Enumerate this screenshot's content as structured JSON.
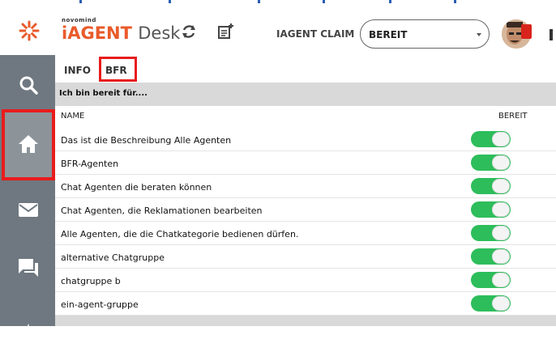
{
  "header": {
    "brand_small": "novomind",
    "brand_main": "iAGENT",
    "brand_desk": "Desk",
    "claim_label": "IAGENT CLAIM",
    "status_value": "BEREIT"
  },
  "tabs": [
    {
      "label": "INFO"
    },
    {
      "label": "BFR"
    }
  ],
  "section": {
    "title": "Ich bin bereit für....",
    "col_name": "NAME",
    "col_ready": "BEREIT"
  },
  "groups": [
    {
      "name": "Das ist die Beschreibung Alle Agenten",
      "ready": true
    },
    {
      "name": "BFR-Agenten",
      "ready": true
    },
    {
      "name": "Chat Agenten die beraten können",
      "ready": true
    },
    {
      "name": "Chat Agenten, die Reklamationen bearbeiten",
      "ready": true
    },
    {
      "name": "Alle Agenten, die die Chatkategorie bedienen dürfen.",
      "ready": true
    },
    {
      "name": "alternative Chatgruppe",
      "ready": true
    },
    {
      "name": "chatgruppe b",
      "ready": true
    },
    {
      "name": "ein-agent-gruppe",
      "ready": true
    }
  ],
  "colors": {
    "brand": "#e95a2b",
    "sidebar": "#6f7880",
    "toggle_on": "#2ebd5b",
    "highlight": "#e81c1c"
  }
}
